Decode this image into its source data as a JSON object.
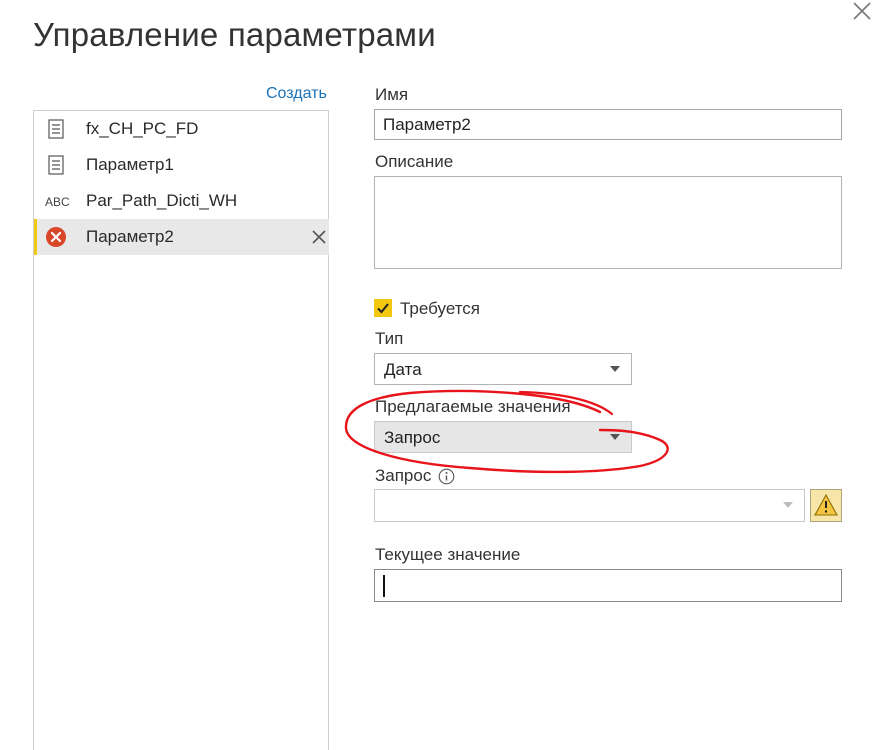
{
  "dialog": {
    "title": "Управление параметрами",
    "create_label": "Создать"
  },
  "parameters_list": [
    {
      "name": "fx_CH_PC_FD",
      "icon": "table-icon",
      "selected": false
    },
    {
      "name": "Параметр1",
      "icon": "table-icon",
      "selected": false
    },
    {
      "name": "Par_Path_Dicti_WH",
      "icon": "text-type-icon",
      "icon_text": "ABC",
      "selected": false
    },
    {
      "name": "Параметр2",
      "icon": "error-icon",
      "selected": true
    }
  ],
  "form": {
    "name_label": "Имя",
    "name_value": "Параметр2",
    "description_label": "Описание",
    "description_value": "",
    "required_label": "Требуется",
    "required_checked": true,
    "type_label": "Тип",
    "type_value": "Дата",
    "suggested_label": "Предлагаемые значения",
    "suggested_value": "Запрос",
    "query_label": "Запрос",
    "query_value": "",
    "current_label": "Текущее значение",
    "current_value": ""
  },
  "colors": {
    "accent_yellow": "#f2c811",
    "link_blue": "#1a73b8",
    "error_red": "#d9472b",
    "annotation_red": "#e8141b",
    "warning_bg": "#f7e6a8"
  }
}
